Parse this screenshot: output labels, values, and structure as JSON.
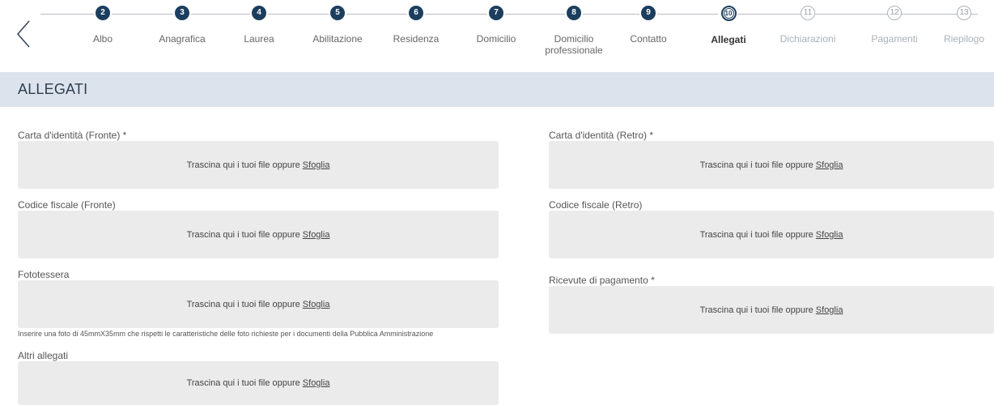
{
  "stepper": {
    "steps": [
      {
        "number": "2",
        "label": "Albo",
        "state": "done"
      },
      {
        "number": "3",
        "label": "Anagrafica",
        "state": "done"
      },
      {
        "number": "4",
        "label": "Laurea",
        "state": "done"
      },
      {
        "number": "5",
        "label": "Abilitazione",
        "state": "done"
      },
      {
        "number": "6",
        "label": "Residenza",
        "state": "done"
      },
      {
        "number": "7",
        "label": "Domicilio",
        "state": "done"
      },
      {
        "number": "8",
        "label": "Domicilio professionale",
        "state": "done"
      },
      {
        "number": "9",
        "label": "Contatto",
        "state": "done"
      },
      {
        "number": "10",
        "label": "Allegati",
        "state": "current"
      },
      {
        "number": "11",
        "label": "Dichiarazioni",
        "state": "future"
      },
      {
        "number": "12",
        "label": "Pagamenti",
        "state": "future"
      },
      {
        "number": "13",
        "label": "Riepilogo",
        "state": "future"
      }
    ]
  },
  "section": {
    "title": "ALLEGATI"
  },
  "dropzone_text": {
    "prompt": "Trascina qui i tuoi file oppure",
    "browse": "Sfoglia"
  },
  "fields": {
    "id_front": {
      "label": "Carta d'identità (Fronte) *"
    },
    "id_back": {
      "label": "Carta d'identità (Retro) *"
    },
    "tax_front": {
      "label": "Codice fiscale (Fronte)"
    },
    "tax_back": {
      "label": "Codice fiscale (Retro)"
    },
    "photo": {
      "label": "Fototessera",
      "hint": "Inserire una foto di 45mmX35mm che rispetti le caratteristiche delle foto richieste per i documenti della Pubblica Amministrazione"
    },
    "receipts": {
      "label": "Ricevute di pagamento *"
    },
    "other": {
      "label": "Altri allegati"
    }
  },
  "colors": {
    "step_done": "#1c3e5e",
    "section_bg": "#dde3ec",
    "dropzone_bg": "#ebebeb"
  }
}
